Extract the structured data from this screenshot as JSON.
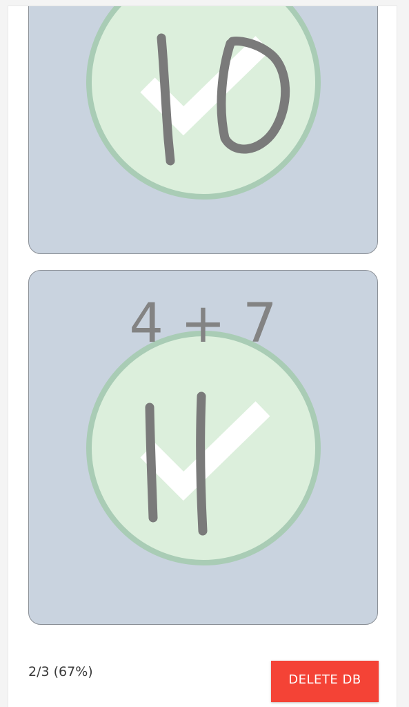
{
  "cards": [
    {
      "question": "",
      "status": "correct",
      "answer_icon": "handwritten-10",
      "result_icon": "checkmark-icon"
    },
    {
      "question": "4 + 7",
      "status": "correct",
      "answer_icon": "handwritten-11",
      "result_icon": "checkmark-icon"
    }
  ],
  "footer": {
    "score": "2/3 (67%)",
    "delete_label": "DELETE DB"
  },
  "colors": {
    "card_bg": "#c9d3df",
    "circle_fill": "#dcefdc",
    "circle_ring": "#a9ccb5",
    "ink": "#7a7a7a",
    "delete": "#f44336"
  }
}
